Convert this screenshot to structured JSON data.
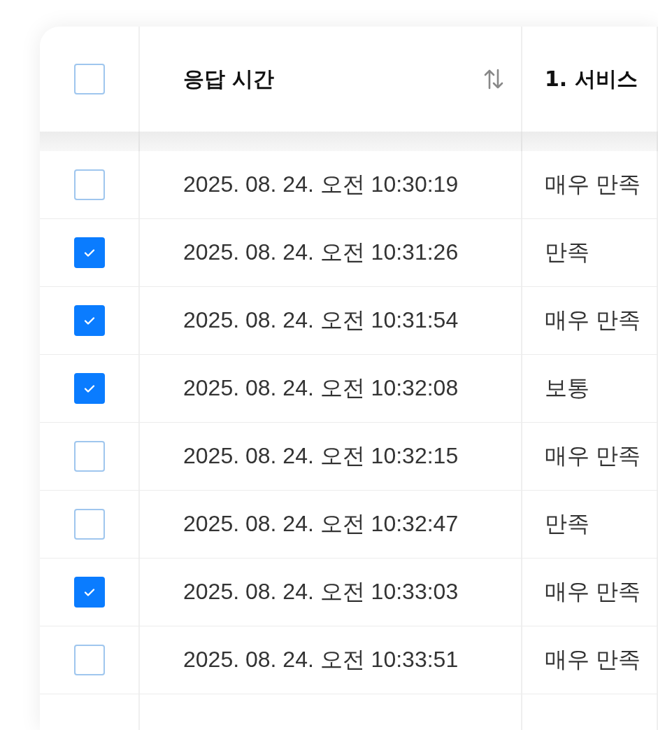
{
  "table": {
    "select_all": {
      "checked": false
    },
    "columns": [
      {
        "label": "응답 시간",
        "sortable": true
      },
      {
        "label": "1. 서비스",
        "sortable": false
      }
    ],
    "rows": [
      {
        "selected": false,
        "time": "2025. 08. 24. 오전 10:30:19",
        "answer": "매우 만족"
      },
      {
        "selected": true,
        "time": "2025. 08. 24. 오전 10:31:26",
        "answer": "만족"
      },
      {
        "selected": true,
        "time": "2025. 08. 24. 오전 10:31:54",
        "answer": "매우 만족"
      },
      {
        "selected": true,
        "time": "2025. 08. 24. 오전 10:32:08",
        "answer": "보통"
      },
      {
        "selected": false,
        "time": "2025. 08. 24. 오전 10:32:15",
        "answer": "매우 만족"
      },
      {
        "selected": false,
        "time": "2025. 08. 24. 오전 10:32:47",
        "answer": "만족"
      },
      {
        "selected": true,
        "time": "2025. 08. 24. 오전 10:33:03",
        "answer": "매우 만족"
      },
      {
        "selected": false,
        "time": "2025. 08. 24. 오전 10:33:51",
        "answer": "매우 만족"
      }
    ]
  }
}
